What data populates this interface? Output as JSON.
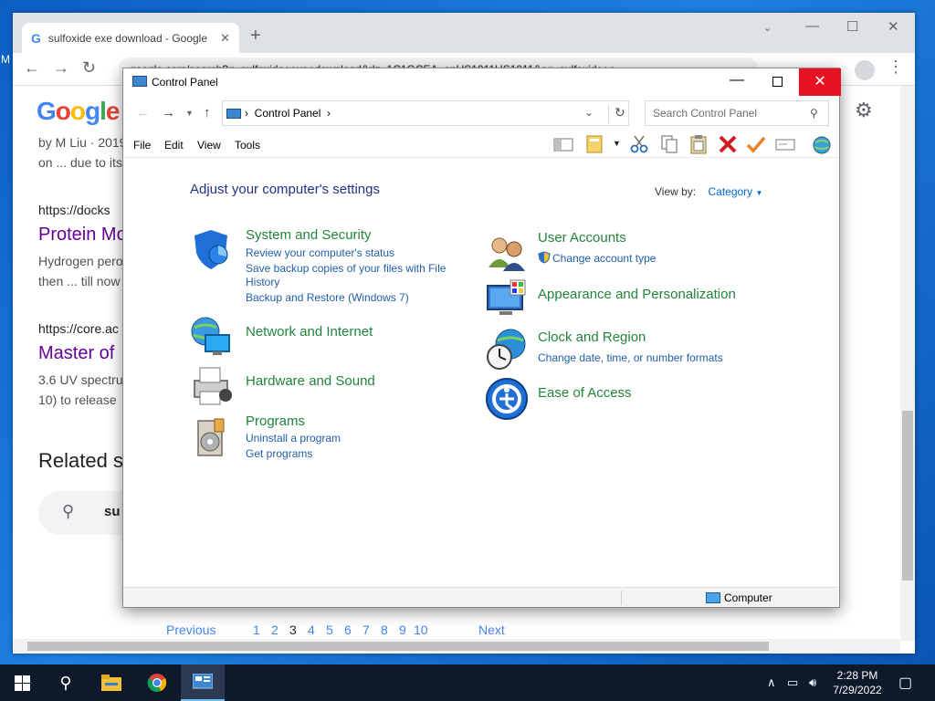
{
  "desktop": {
    "edge_letter": "M"
  },
  "browser": {
    "tab_title": "sulfoxide exe download - Google",
    "omnibox": "google.com/search?q=sulfoxide+exe+download&rlz=1C1GCEA_enUS1011US1011&oq=sulfoxide+e",
    "results": [
      {
        "snippet1": "by M Liu · 2019",
        "snippet2": "on ... due to its"
      },
      {
        "url": "https://docks",
        "title": "Protein Mo",
        "snippet1": "Hydrogen pero",
        "snippet2": "then ... till now"
      },
      {
        "url": "https://core.ac",
        "title": "Master of",
        "snippet1": "3.6 UV spectru",
        "snippet2": "10) to release"
      }
    ],
    "related_heading": "Related s",
    "related_pill_text": "su",
    "pager": {
      "previous": "Previous",
      "pages": [
        "1",
        "2",
        "3",
        "4",
        "5",
        "6",
        "7",
        "8",
        "9",
        "10"
      ],
      "current": "3",
      "next": "Next"
    }
  },
  "control_panel": {
    "window_title": "Control Panel",
    "breadcrumb": "Control Panel",
    "search_placeholder": "Search Control Panel",
    "menu": {
      "file": "File",
      "edit": "Edit",
      "view": "View",
      "tools": "Tools"
    },
    "heading": "Adjust your computer's settings",
    "view_by_label": "View by:",
    "view_by_value": "Category",
    "categories_left": [
      {
        "title": "System and Security",
        "links": [
          "Review your computer's status",
          "Save backup copies of your files with File",
          "History",
          "Backup and Restore (Windows 7)"
        ]
      },
      {
        "title": "Network and Internet",
        "links": []
      },
      {
        "title": "Hardware and Sound",
        "links": []
      },
      {
        "title": "Programs",
        "links": [
          "Uninstall a program",
          "Get programs"
        ]
      }
    ],
    "categories_right": [
      {
        "title": "User Accounts",
        "links": [
          "Change account type"
        ]
      },
      {
        "title": "Appearance and Personalization",
        "links": []
      },
      {
        "title": "Clock and Region",
        "links": [
          "Change date, time, or number formats"
        ]
      },
      {
        "title": "Ease of Access",
        "links": []
      }
    ],
    "status_location": "Computer"
  },
  "taskbar": {
    "time": "2:28 PM",
    "date": "7/29/2022"
  },
  "colors": {
    "category_green": "#21843b",
    "link_blue": "#1f5ea8",
    "heading_blue": "#1e3287",
    "close_red": "#e81123",
    "taskbar": "#0e1a2b"
  }
}
